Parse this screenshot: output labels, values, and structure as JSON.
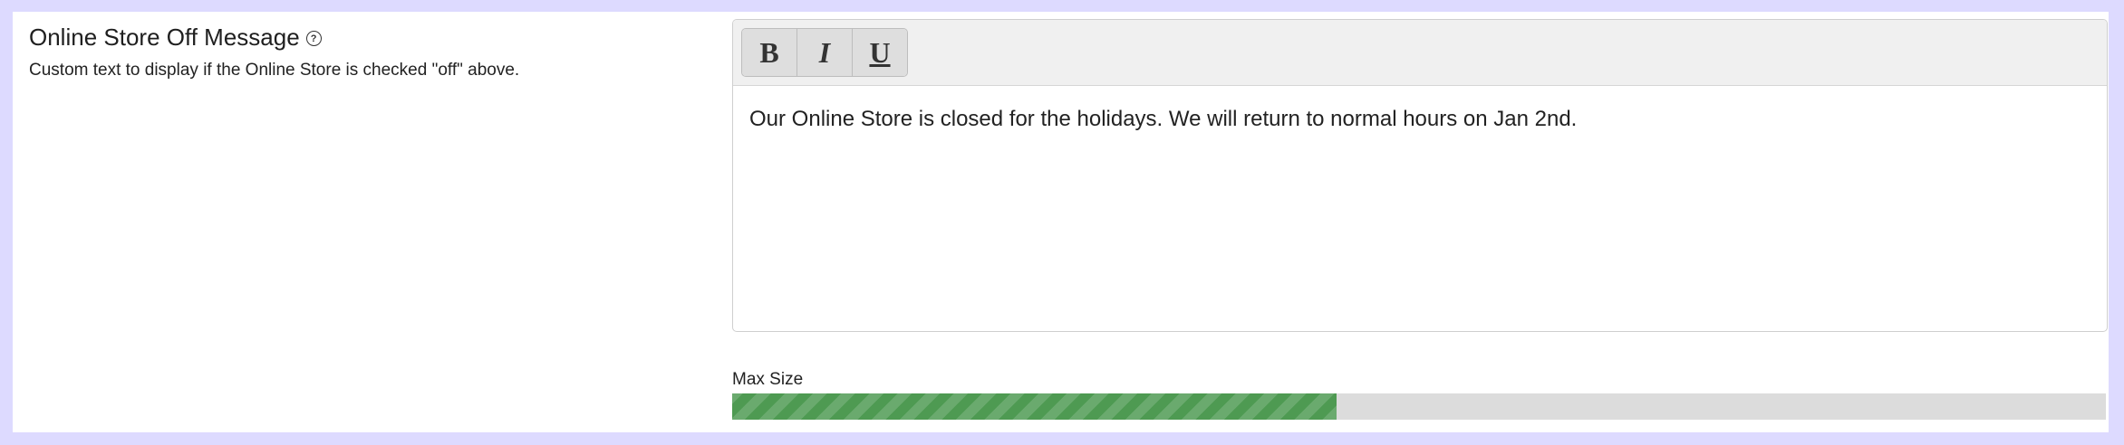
{
  "setting": {
    "title": "Online Store Off Message",
    "help_icon": "help-circle-icon",
    "description": "Custom text to display if the Online Store is checked \"off\" above."
  },
  "editor": {
    "toolbar": {
      "bold_label": "B",
      "italic_label": "I",
      "underline_label": "U"
    },
    "content": "Our Online Store is closed for the holidays. We will return to normal hours on Jan 2nd."
  },
  "size_meter": {
    "label": "Max Size",
    "fill_fraction": 0.44,
    "fill_color": "#4e9a52"
  }
}
